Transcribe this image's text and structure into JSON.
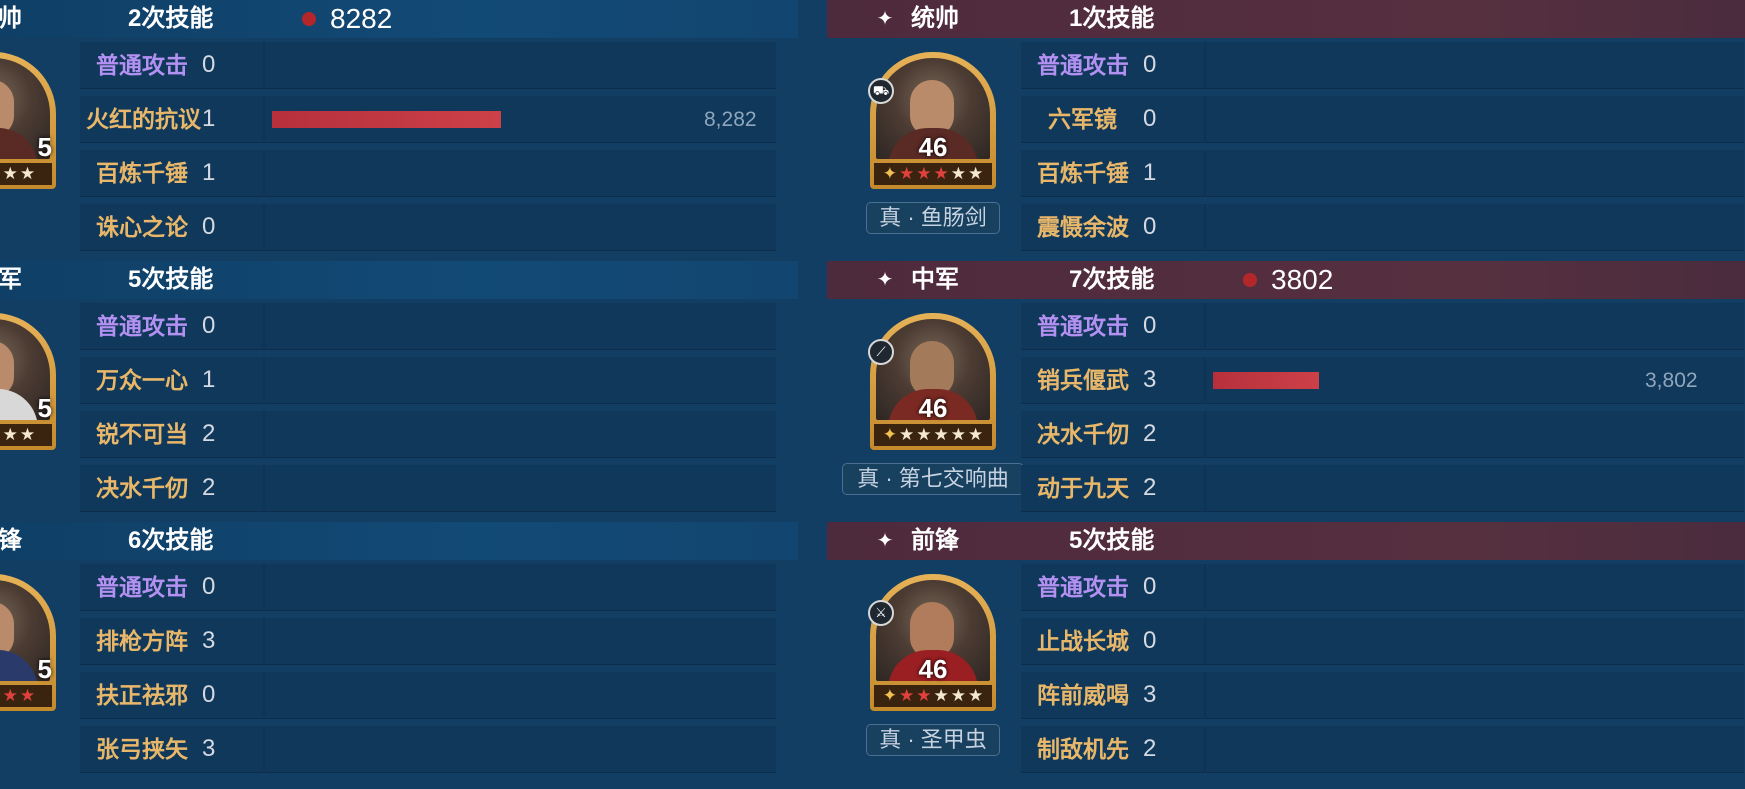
{
  "left": {
    "sections": [
      {
        "role": "帅",
        "count": "2次技能",
        "damage": "8282",
        "portrait": {
          "level": "5"
        },
        "skills": [
          {
            "name": "普通攻击",
            "uses": "0",
            "normal": true
          },
          {
            "name": "火红的抗议",
            "uses": "1",
            "bar": 0.4,
            "value": "8,282"
          },
          {
            "name": "百炼千锤",
            "uses": "1"
          },
          {
            "name": "诛心之论",
            "uses": "0"
          }
        ]
      },
      {
        "role": "军",
        "count": "5次技能",
        "portrait": {
          "level": "5"
        },
        "skills": [
          {
            "name": "普通攻击",
            "uses": "0",
            "normal": true
          },
          {
            "name": "万众一心",
            "uses": "1"
          },
          {
            "name": "锐不可当",
            "uses": "2"
          },
          {
            "name": "决水千仞",
            "uses": "2"
          }
        ]
      },
      {
        "role": "锋",
        "count": "6次技能",
        "portrait": {
          "level": "5"
        },
        "skills": [
          {
            "name": "普通攻击",
            "uses": "0",
            "normal": true
          },
          {
            "name": "排枪方阵",
            "uses": "3"
          },
          {
            "name": "扶正祛邪",
            "uses": "0"
          },
          {
            "name": "张弓挟矢",
            "uses": "3"
          }
        ]
      }
    ]
  },
  "right": {
    "sections": [
      {
        "role": "统帅",
        "count": "1次技能",
        "portrait": {
          "level": "46",
          "badge": "chariot-icon"
        },
        "treasure": "真 · 鱼肠剑",
        "skills": [
          {
            "name": "普通攻击",
            "uses": "0",
            "normal": true
          },
          {
            "name": "六军镜",
            "uses": "0"
          },
          {
            "name": "百炼千锤",
            "uses": "1"
          },
          {
            "name": "震慑余波",
            "uses": "0"
          }
        ]
      },
      {
        "role": "中军",
        "count": "7次技能",
        "damage": "3802",
        "portrait": {
          "level": "46",
          "badge": "spear-icon"
        },
        "treasure": "真 · 第七交响曲",
        "skills": [
          {
            "name": "普通攻击",
            "uses": "0",
            "normal": true
          },
          {
            "name": "销兵偃武",
            "uses": "3",
            "bar": 0.19,
            "value": "3,802"
          },
          {
            "name": "决水千仞",
            "uses": "2"
          },
          {
            "name": "动于九天",
            "uses": "2"
          }
        ]
      },
      {
        "role": "前锋",
        "count": "5次技能",
        "portrait": {
          "level": "46",
          "badge": "sword-icon"
        },
        "treasure": "真 · 圣甲虫",
        "skills": [
          {
            "name": "普通攻击",
            "uses": "0",
            "normal": true
          },
          {
            "name": "止战长城",
            "uses": "0"
          },
          {
            "name": "阵前威喝",
            "uses": "3"
          },
          {
            "name": "制敌机先",
            "uses": "2"
          }
        ]
      }
    ]
  }
}
